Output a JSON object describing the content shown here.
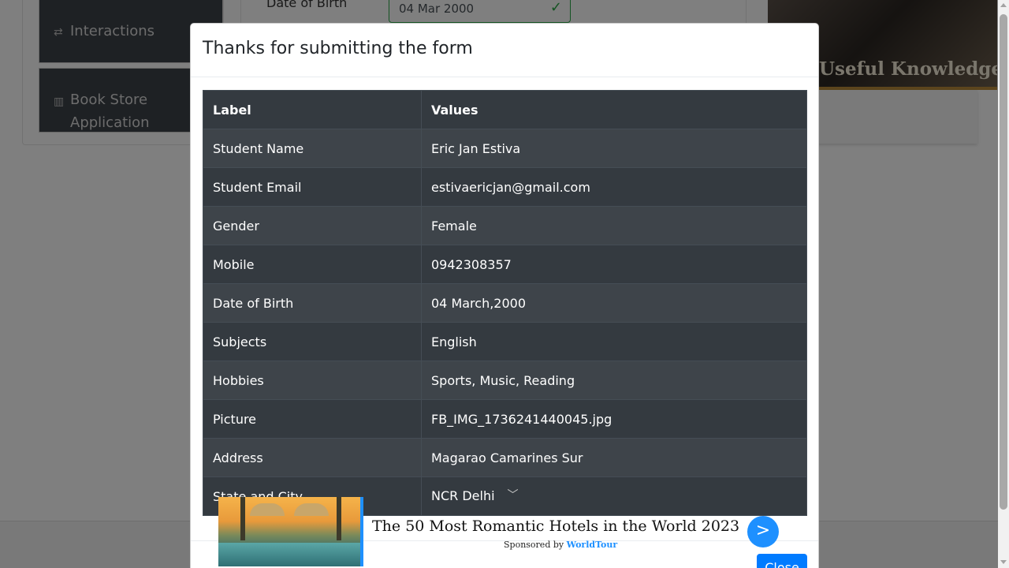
{
  "background": {
    "sidebar": [
      {
        "label": "Interactions",
        "icon": "interactions-icon"
      },
      {
        "label": "Book Store Application",
        "label_line1": "Book Store",
        "label_line2": "Application",
        "icon": "books-icon"
      }
    ],
    "form_field_label": "Date of Birth",
    "form_field_value": "04 Mar 2000",
    "banner_text": "Useful Knowledge"
  },
  "modal": {
    "title": "Thanks for submitting the form",
    "table": {
      "headers": [
        "Label",
        "Values"
      ],
      "rows": [
        {
          "label": "Student Name",
          "value": "Eric Jan Estiva"
        },
        {
          "label": "Student Email",
          "value": "estivaericjan@gmail.com"
        },
        {
          "label": "Gender",
          "value": "Female"
        },
        {
          "label": "Mobile",
          "value": "0942308357"
        },
        {
          "label": "Date of Birth",
          "value": "04 March,2000"
        },
        {
          "label": "Subjects",
          "value": "English"
        },
        {
          "label": "Hobbies",
          "value": "Sports, Music, Reading"
        },
        {
          "label": "Picture",
          "value": "FB_IMG_1736241440045.jpg"
        },
        {
          "label": "Address",
          "value": "Magarao Camarines Sur"
        },
        {
          "label": "State and City",
          "value": "NCR Delhi"
        }
      ]
    },
    "close_label": "Close"
  },
  "ad": {
    "title": "The 50 Most Romantic Hotels in the World 2023",
    "sponsored_prefix": "Sponsored by",
    "sponsor": "WorldTour",
    "go_label": ">"
  },
  "colors": {
    "accent": "#007bff",
    "table_dark": "#343a40",
    "table_stripe": "#3e444a",
    "success": "#28a745",
    "ad_blue": "#1e90ff"
  }
}
